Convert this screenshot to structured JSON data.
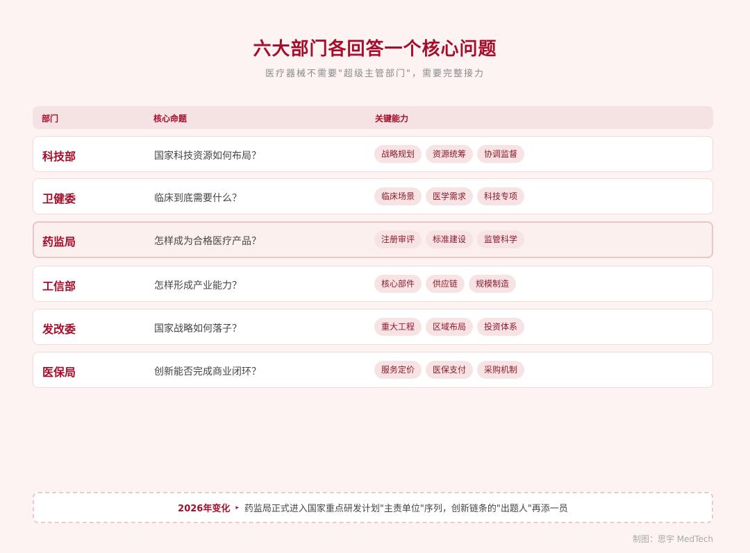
{
  "header": {
    "title": "六大部门各回答一个核心问题",
    "subtitle": "医疗器械不需要\"超级主管部门\"，需要完整接力"
  },
  "table": {
    "columns": [
      "部门",
      "核心命题",
      "关键能力"
    ],
    "rows": [
      {
        "dept": "科技部",
        "proposition": "国家科技资源如何布局？",
        "tags": [
          "战略规划",
          "资源统筹",
          "协调监督"
        ]
      },
      {
        "dept": "卫健委",
        "proposition": "临床到底需要什么？",
        "tags": [
          "临床场景",
          "医学需求",
          "科技专项"
        ]
      },
      {
        "dept": "药监局",
        "proposition": "怎样成为合格医疗产品？",
        "tags": [
          "注册审评",
          "标准建设",
          "监管科学"
        ]
      },
      {
        "dept": "工信部",
        "proposition": "怎样形成产业能力？",
        "tags": [
          "核心部件",
          "供应链",
          "规模制造"
        ]
      },
      {
        "dept": "发改委",
        "proposition": "国家战略如何落子？",
        "tags": [
          "重大工程",
          "区域布局",
          "投资体系"
        ]
      },
      {
        "dept": "医保局",
        "proposition": "创新能否完成商业闭环？",
        "tags": [
          "服务定价",
          "医保支付",
          "采购机制"
        ]
      }
    ]
  },
  "footer": {
    "year_label": "2026年变化",
    "arrow_icon": "▸",
    "text": "药监局正式进入国家重点研发计划\"主责单位\"序列，创新链条的\"出题人\"再添一员"
  },
  "credit": "制图：思宇 MedTech",
  "colors": {
    "accent": "#a50d2a",
    "background": "#fdf3f2",
    "tag_bg": "#f7e3e3"
  }
}
